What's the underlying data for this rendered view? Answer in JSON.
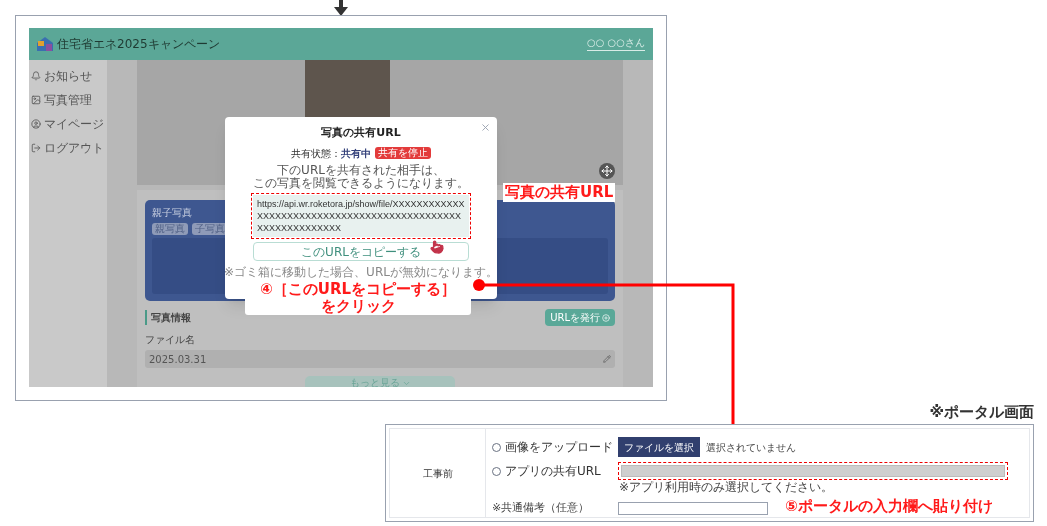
{
  "app": {
    "header": {
      "logo_text": "住宅省エネ2025キャンペーン",
      "user": "○○ ○○さん"
    },
    "sidebar": {
      "items": [
        {
          "kind": "bell",
          "label": "お知らせ"
        },
        {
          "kind": "image",
          "label": "写真管理"
        },
        {
          "kind": "user",
          "label": "マイページ"
        },
        {
          "kind": "logout",
          "label": "ログアウト"
        }
      ]
    },
    "parent_child": {
      "title": "親子写真",
      "tags": [
        "親写真",
        "子写真"
      ]
    },
    "photo_info": {
      "title": "写真情報",
      "issue_button": "URLを発行",
      "file_label": "ファイル名",
      "file_value": "2025.03.31",
      "more_button": "もっと見る"
    },
    "modal": {
      "title": "写真の共有URL",
      "status_label": "共有状態：",
      "status_value": "共有中",
      "stop_button": "共有を停止",
      "description": [
        "下のURLを共有された相手は、",
        "この写真を閲覧できるようになります。"
      ],
      "url": "https://api.wr.roketora.jp/show/file/XXXXXXXXXXXXXXXXXXXXXXXXXXXXXXXXXXXXXXXXXXXXXXXXXXXXXXXXXXXX",
      "copy_button": "このURLをコピーする",
      "note": "※ゴミ箱に移動した場合、URLが無効になります。"
    }
  },
  "annotations": {
    "url_label": "写真の共有URL",
    "step4": [
      "④［このURLをコピーする］",
      "をクリック"
    ],
    "step5": "⑤ポータルの入力欄へ貼り付け"
  },
  "portal": {
    "heading": "※ポータル画面",
    "section": "工事前",
    "rows": [
      {
        "kind": "upload",
        "label": "画像をアップロード",
        "selected": false,
        "button": "ファイルを選択",
        "status": "選択されていません"
      },
      {
        "kind": "url",
        "label": "アプリの共有URL",
        "selected": false,
        "note": "※アプリ利用時のみ選択してください。"
      }
    ],
    "remark_label": "※共通備考（任意）"
  }
}
